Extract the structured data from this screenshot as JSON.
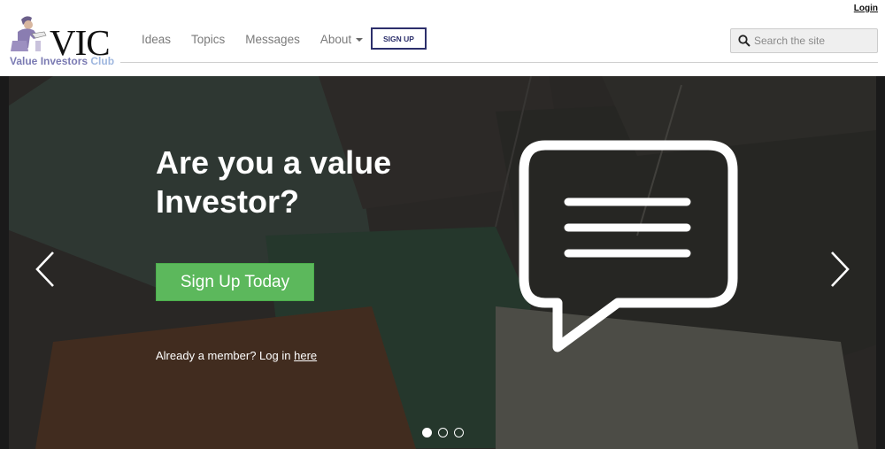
{
  "header": {
    "login_label": "Login",
    "logo_title": "VIC",
    "logo_subtitle_main": "Value Investors",
    "logo_subtitle_club": "Club",
    "nav": {
      "ideas": "Ideas",
      "topics": "Topics",
      "messages": "Messages",
      "about": "About"
    },
    "signup_label": "SIGN UP",
    "search_placeholder": "Search the site"
  },
  "hero": {
    "title": "Are you a value Investor?",
    "cta_label": "Sign Up Today",
    "member_prefix": "Already a member? Log in",
    "member_link": "here",
    "slides": {
      "count": 3,
      "active_index": 0
    }
  },
  "colors": {
    "brand_navy": "#2c2f6b",
    "cta_green": "#5cb85c",
    "logo_purple": "#7b7bb3",
    "logo_light_blue": "#9fb7df"
  },
  "icons": [
    "logo-figure-icon",
    "search-icon",
    "chat-bubble-icon",
    "chevron-left-icon",
    "chevron-right-icon"
  ]
}
